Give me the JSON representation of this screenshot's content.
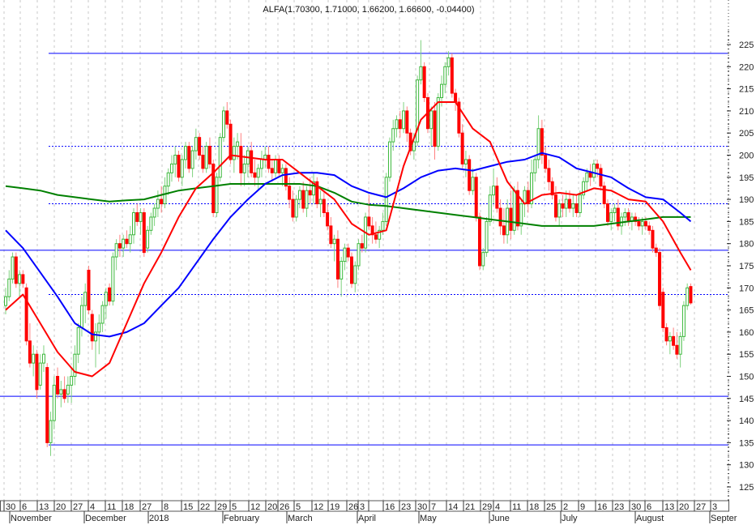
{
  "chart_data": {
    "type": "candlestick",
    "title": "ALFA(1.70300, 1.71000, 1.66200, 1.66600, -0.04400)",
    "ylim": [
      1.22,
      2.28
    ],
    "y_ticks": [
      "125",
      "130",
      "135",
      "140",
      "145",
      "150",
      "155",
      "160",
      "165",
      "170",
      "175",
      "180",
      "185",
      "190",
      "195",
      "200",
      "205",
      "210",
      "215",
      "220",
      "225"
    ],
    "y_tick_values": [
      1.25,
      1.3,
      1.35,
      1.4,
      1.45,
      1.5,
      1.55,
      1.6,
      1.65,
      1.7,
      1.75,
      1.8,
      1.85,
      1.9,
      1.95,
      2.0,
      2.05,
      2.1,
      2.15,
      2.2,
      2.25
    ],
    "x_day_ticks": [
      "30",
      "6",
      "13",
      "20",
      "27",
      "4",
      "11",
      "18",
      "27",
      "8",
      "15",
      "22",
      "29",
      "5",
      "12",
      "20",
      "26",
      "5",
      "12",
      "19",
      "26",
      "3",
      "",
      "16",
      "23",
      "30",
      "7",
      "14",
      "21",
      "29",
      "4",
      "11",
      "18",
      "25",
      "2",
      "9",
      "16",
      "23",
      "30",
      "6",
      "13",
      "20",
      "27",
      "3"
    ],
    "x_month_labels": [
      "November",
      "December",
      "2018",
      "February",
      "March",
      "April",
      "May",
      "June",
      "July",
      "August",
      "Septer"
    ],
    "grid": "vertical dotted",
    "colors": {
      "up": "#3cb83c",
      "down": "#ff0000",
      "ma_short": "#ff0000",
      "ma_mid": "#0000ff",
      "ma_long": "#008000",
      "levels": "#0000ff"
    },
    "horizontal_levels": {
      "solid": [
        2.23,
        1.785,
        1.455,
        1.345
      ],
      "dotted": [
        2.02,
        1.89,
        1.685
      ]
    },
    "candles_ohlc": [
      [
        1.66,
        1.7,
        1.64,
        1.68
      ],
      [
        1.68,
        1.74,
        1.67,
        1.72
      ],
      [
        1.72,
        1.78,
        1.71,
        1.77
      ],
      [
        1.77,
        1.78,
        1.7,
        1.71
      ],
      [
        1.71,
        1.74,
        1.68,
        1.73
      ],
      [
        1.73,
        1.74,
        1.7,
        1.71
      ],
      [
        1.7,
        1.71,
        1.57,
        1.58
      ],
      [
        1.58,
        1.62,
        1.52,
        1.53
      ],
      [
        1.53,
        1.57,
        1.5,
        1.55
      ],
      [
        1.55,
        1.56,
        1.45,
        1.47
      ],
      [
        1.48,
        1.55,
        1.47,
        1.53
      ],
      [
        1.53,
        1.57,
        1.51,
        1.55
      ],
      [
        1.52,
        1.53,
        1.34,
        1.35
      ],
      [
        1.35,
        1.42,
        1.32,
        1.4
      ],
      [
        1.4,
        1.5,
        1.38,
        1.48
      ],
      [
        1.5,
        1.52,
        1.45,
        1.46
      ],
      [
        1.46,
        1.49,
        1.43,
        1.47
      ],
      [
        1.47,
        1.5,
        1.44,
        1.45
      ],
      [
        1.46,
        1.5,
        1.44,
        1.48
      ],
      [
        1.48,
        1.52,
        1.44,
        1.5
      ],
      [
        1.5,
        1.57,
        1.48,
        1.55
      ],
      [
        1.55,
        1.62,
        1.53,
        1.61
      ],
      [
        1.61,
        1.68,
        1.59,
        1.66
      ],
      [
        1.66,
        1.71,
        1.62,
        1.69
      ],
      [
        1.74,
        1.75,
        1.64,
        1.65
      ],
      [
        1.64,
        1.65,
        1.56,
        1.58
      ],
      [
        1.58,
        1.62,
        1.52,
        1.6
      ],
      [
        1.6,
        1.64,
        1.55,
        1.62
      ],
      [
        1.62,
        1.67,
        1.6,
        1.66
      ],
      [
        1.66,
        1.7,
        1.63,
        1.69
      ],
      [
        1.7,
        1.71,
        1.66,
        1.67
      ],
      [
        1.67,
        1.78,
        1.66,
        1.77
      ],
      [
        1.77,
        1.81,
        1.74,
        1.8
      ],
      [
        1.8,
        1.82,
        1.77,
        1.79
      ],
      [
        1.79,
        1.82,
        1.77,
        1.81
      ],
      [
        1.81,
        1.83,
        1.79,
        1.8
      ],
      [
        1.8,
        1.84,
        1.78,
        1.82
      ],
      [
        1.82,
        1.88,
        1.8,
        1.87
      ],
      [
        1.87,
        1.89,
        1.84,
        1.85
      ],
      [
        1.85,
        1.88,
        1.82,
        1.87
      ],
      [
        1.87,
        1.88,
        1.77,
        1.78
      ],
      [
        1.79,
        1.84,
        1.78,
        1.83
      ],
      [
        1.83,
        1.87,
        1.82,
        1.86
      ],
      [
        1.86,
        1.89,
        1.84,
        1.88
      ],
      [
        1.88,
        1.92,
        1.86,
        1.9
      ],
      [
        1.9,
        1.93,
        1.87,
        1.89
      ],
      [
        1.89,
        1.95,
        1.88,
        1.93
      ],
      [
        1.93,
        1.97,
        1.91,
        1.96
      ],
      [
        1.96,
        2.0,
        1.94,
        1.98
      ],
      [
        1.98,
        2.02,
        1.95,
        2.0
      ],
      [
        2.0,
        2.01,
        1.94,
        1.95
      ],
      [
        1.95,
        2.0,
        1.93,
        1.99
      ],
      [
        1.99,
        2.03,
        1.97,
        2.02
      ],
      [
        2.02,
        2.03,
        1.96,
        1.97
      ],
      [
        1.97,
        2.02,
        1.95,
        2.01
      ],
      [
        2.01,
        2.06,
        1.99,
        2.04
      ],
      [
        2.04,
        2.05,
        1.99,
        2.0
      ],
      [
        2.0,
        2.02,
        1.96,
        1.97
      ],
      [
        1.97,
        2.03,
        1.96,
        2.02
      ],
      [
        2.02,
        2.04,
        1.97,
        1.98
      ],
      [
        1.98,
        1.99,
        1.86,
        1.87
      ],
      [
        1.87,
        1.96,
        1.86,
        1.95
      ],
      [
        1.95,
        2.05,
        1.94,
        2.04
      ],
      [
        2.04,
        2.11,
        2.03,
        2.1
      ],
      [
        2.1,
        2.12,
        2.06,
        2.07
      ],
      [
        2.07,
        2.08,
        1.98,
        1.99
      ],
      [
        1.99,
        2.04,
        1.96,
        2.02
      ],
      [
        2.02,
        2.05,
        1.99,
        2.03
      ],
      [
        2.02,
        2.05,
        1.93,
        1.96
      ],
      [
        1.96,
        2.0,
        1.93,
        1.98
      ],
      [
        1.98,
        2.02,
        1.95,
        2.01
      ],
      [
        2.01,
        2.03,
        1.95,
        1.96
      ],
      [
        1.96,
        1.99,
        1.93,
        1.95
      ],
      [
        1.95,
        1.98,
        1.92,
        1.97
      ],
      [
        1.97,
        2.01,
        1.95,
        1.99
      ],
      [
        1.99,
        2.02,
        1.97,
        2.0
      ],
      [
        2.0,
        2.02,
        1.96,
        1.97
      ],
      [
        1.97,
        1.99,
        1.94,
        1.96
      ],
      [
        1.96,
        2.0,
        1.95,
        1.99
      ],
      [
        1.99,
        2.0,
        1.95,
        1.96
      ],
      [
        1.96,
        1.98,
        1.93,
        1.97
      ],
      [
        1.97,
        1.98,
        1.92,
        1.93
      ],
      [
        1.93,
        1.95,
        1.88,
        1.9
      ],
      [
        1.9,
        1.92,
        1.85,
        1.86
      ],
      [
        1.86,
        1.91,
        1.85,
        1.9
      ],
      [
        1.9,
        1.93,
        1.88,
        1.92
      ],
      [
        1.92,
        1.94,
        1.87,
        1.88
      ],
      [
        1.88,
        1.93,
        1.86,
        1.92
      ],
      [
        1.92,
        1.95,
        1.89,
        1.91
      ],
      [
        1.91,
        1.96,
        1.89,
        1.94
      ],
      [
        1.94,
        1.95,
        1.88,
        1.89
      ],
      [
        1.89,
        1.92,
        1.86,
        1.9
      ],
      [
        1.9,
        1.92,
        1.86,
        1.87
      ],
      [
        1.87,
        1.89,
        1.83,
        1.84
      ],
      [
        1.84,
        1.86,
        1.79,
        1.8
      ],
      [
        1.8,
        1.82,
        1.76,
        1.81
      ],
      [
        1.81,
        1.83,
        1.7,
        1.72
      ],
      [
        1.72,
        1.77,
        1.68,
        1.76
      ],
      [
        1.76,
        1.8,
        1.74,
        1.79
      ],
      [
        1.79,
        1.8,
        1.76,
        1.77
      ],
      [
        1.77,
        1.78,
        1.7,
        1.71
      ],
      [
        1.71,
        1.76,
        1.69,
        1.75
      ],
      [
        1.75,
        1.81,
        1.74,
        1.8
      ],
      [
        1.8,
        1.82,
        1.78,
        1.79
      ],
      [
        1.79,
        1.87,
        1.78,
        1.86
      ],
      [
        1.86,
        1.91,
        1.83,
        1.84
      ],
      [
        1.84,
        1.86,
        1.8,
        1.82
      ],
      [
        1.82,
        1.85,
        1.8,
        1.81
      ],
      [
        1.81,
        1.84,
        1.79,
        1.83
      ],
      [
        1.83,
        1.87,
        1.82,
        1.85
      ],
      [
        1.85,
        1.96,
        1.84,
        1.95
      ],
      [
        1.95,
        2.04,
        1.94,
        2.03
      ],
      [
        2.03,
        2.08,
        2.01,
        2.06
      ],
      [
        2.06,
        2.09,
        2.04,
        2.08
      ],
      [
        2.08,
        2.1,
        2.04,
        2.06
      ],
      [
        2.06,
        2.12,
        2.05,
        2.1
      ],
      [
        2.1,
        2.11,
        2.03,
        2.05
      ],
      [
        2.05,
        2.06,
        2.0,
        2.01
      ],
      [
        2.01,
        2.05,
        1.99,
        2.03
      ],
      [
        2.03,
        2.18,
        2.02,
        2.17
      ],
      [
        2.17,
        2.26,
        2.16,
        2.2
      ],
      [
        2.2,
        2.21,
        2.12,
        2.13
      ],
      [
        2.13,
        2.14,
        2.05,
        2.06
      ],
      [
        2.06,
        2.11,
        2.02,
        2.1
      ],
      [
        2.1,
        2.12,
        1.99,
        2.02
      ],
      [
        2.02,
        2.14,
        2.01,
        2.13
      ],
      [
        2.13,
        2.18,
        2.11,
        2.16
      ],
      [
        2.16,
        2.21,
        2.14,
        2.2
      ],
      [
        2.2,
        2.235,
        2.18,
        2.22
      ],
      [
        2.22,
        2.23,
        2.13,
        2.14
      ],
      [
        2.14,
        2.15,
        2.1,
        2.12
      ],
      [
        2.12,
        2.13,
        2.04,
        2.05
      ],
      [
        2.05,
        2.07,
        1.97,
        1.98
      ],
      [
        1.98,
        2.01,
        1.95,
        1.99
      ],
      [
        1.99,
        2.0,
        1.91,
        1.92
      ],
      [
        1.92,
        1.97,
        1.91,
        1.95
      ],
      [
        1.95,
        1.96,
        1.85,
        1.86
      ],
      [
        1.86,
        1.87,
        1.74,
        1.75
      ],
      [
        1.75,
        1.79,
        1.74,
        1.78
      ],
      [
        1.78,
        1.86,
        1.77,
        1.85
      ],
      [
        1.85,
        1.93,
        1.84,
        1.91
      ],
      [
        1.91,
        1.97,
        1.89,
        1.93
      ],
      [
        1.93,
        1.95,
        1.87,
        1.88
      ],
      [
        1.88,
        1.9,
        1.82,
        1.84
      ],
      [
        1.84,
        1.88,
        1.8,
        1.82
      ],
      [
        1.82,
        1.9,
        1.8,
        1.88
      ],
      [
        1.88,
        1.92,
        1.81,
        1.83
      ],
      [
        1.83,
        1.93,
        1.82,
        1.92
      ],
      [
        1.92,
        1.94,
        1.83,
        1.84
      ],
      [
        1.84,
        1.9,
        1.82,
        1.89
      ],
      [
        1.89,
        1.93,
        1.86,
        1.92
      ],
      [
        1.92,
        1.94,
        1.87,
        1.89
      ],
      [
        1.89,
        1.99,
        1.88,
        1.96
      ],
      [
        1.96,
        2.0,
        1.94,
        1.99
      ],
      [
        1.99,
        2.09,
        1.97,
        2.06
      ],
      [
        2.06,
        2.08,
        1.98,
        2.0
      ],
      [
        2.0,
        2.02,
        1.96,
        1.97
      ],
      [
        1.97,
        1.99,
        1.92,
        1.94
      ],
      [
        1.94,
        1.95,
        1.9,
        1.91
      ],
      [
        1.91,
        1.93,
        1.85,
        1.86
      ],
      [
        1.86,
        1.9,
        1.84,
        1.89
      ],
      [
        1.89,
        1.91,
        1.86,
        1.88
      ],
      [
        1.88,
        1.92,
        1.86,
        1.9
      ],
      [
        1.9,
        1.92,
        1.87,
        1.88
      ],
      [
        1.88,
        1.91,
        1.86,
        1.89
      ],
      [
        1.89,
        1.91,
        1.86,
        1.87
      ],
      [
        1.87,
        1.92,
        1.86,
        1.91
      ],
      [
        1.91,
        1.95,
        1.9,
        1.94
      ],
      [
        1.94,
        1.97,
        1.92,
        1.96
      ],
      [
        1.96,
        1.98,
        1.93,
        1.95
      ],
      [
        1.95,
        1.99,
        1.94,
        1.98
      ],
      [
        1.98,
        1.99,
        1.95,
        1.97
      ],
      [
        1.97,
        1.98,
        1.92,
        1.93
      ],
      [
        1.93,
        1.94,
        1.88,
        1.89
      ],
      [
        1.89,
        1.9,
        1.84,
        1.85
      ],
      [
        1.85,
        1.88,
        1.83,
        1.87
      ],
      [
        1.87,
        1.89,
        1.85,
        1.88
      ],
      [
        1.88,
        1.9,
        1.83,
        1.84
      ],
      [
        1.84,
        1.87,
        1.82,
        1.86
      ],
      [
        1.86,
        1.88,
        1.84,
        1.87
      ],
      [
        1.87,
        1.88,
        1.84,
        1.85
      ],
      [
        1.85,
        1.87,
        1.83,
        1.86
      ],
      [
        1.86,
        1.87,
        1.84,
        1.85
      ],
      [
        1.85,
        1.86,
        1.83,
        1.84
      ],
      [
        1.84,
        1.86,
        1.82,
        1.85
      ],
      [
        1.85,
        1.86,
        1.83,
        1.84
      ],
      [
        1.84,
        1.85,
        1.82,
        1.83
      ],
      [
        1.83,
        1.84,
        1.78,
        1.79
      ],
      [
        1.79,
        1.8,
        1.77,
        1.78
      ],
      [
        1.78,
        1.79,
        1.65,
        1.66
      ],
      [
        1.69,
        1.7,
        1.6,
        1.61
      ],
      [
        1.61,
        1.62,
        1.57,
        1.58
      ],
      [
        1.58,
        1.6,
        1.55,
        1.59
      ],
      [
        1.59,
        1.61,
        1.56,
        1.57
      ],
      [
        1.57,
        1.6,
        1.54,
        1.55
      ],
      [
        1.55,
        1.6,
        1.52,
        1.59
      ],
      [
        1.59,
        1.67,
        1.58,
        1.66
      ],
      [
        1.66,
        1.71,
        1.65,
        1.7
      ],
      [
        1.703,
        1.71,
        1.662,
        1.666
      ]
    ],
    "moving_averages_weekly_samples": {
      "red": [
        1.65,
        1.685,
        1.62,
        1.555,
        1.51,
        1.5,
        1.53,
        1.62,
        1.71,
        1.78,
        1.86,
        1.925,
        1.96,
        2.0,
        1.995,
        1.99,
        1.99,
        1.96,
        1.93,
        1.9,
        1.845,
        1.82,
        1.83,
        1.975,
        2.08,
        2.12,
        2.12,
        2.06,
        2.03,
        1.94,
        1.89,
        1.91,
        1.915,
        1.91,
        1.925,
        1.92,
        1.9,
        1.895,
        1.85,
        1.78,
        1.74
      ],
      "blue": [
        1.83,
        1.79,
        1.735,
        1.68,
        1.62,
        1.595,
        1.59,
        1.6,
        1.62,
        1.66,
        1.7,
        1.755,
        1.81,
        1.86,
        1.9,
        1.935,
        1.955,
        1.96,
        1.96,
        1.955,
        1.93,
        1.915,
        1.905,
        1.925,
        1.95,
        1.965,
        1.97,
        1.965,
        1.975,
        1.985,
        1.99,
        2.005,
        1.995,
        1.97,
        1.96,
        1.95,
        1.925,
        1.905,
        1.9,
        1.87,
        1.85
      ],
      "green": [
        1.93,
        1.925,
        1.92,
        1.91,
        1.905,
        1.9,
        1.895,
        1.898,
        1.9,
        1.91,
        1.92,
        1.925,
        1.93,
        1.935,
        1.935,
        1.935,
        1.935,
        1.935,
        1.93,
        1.915,
        1.895,
        1.888,
        1.885,
        1.88,
        1.875,
        1.87,
        1.865,
        1.86,
        1.855,
        1.85,
        1.845,
        1.84,
        1.84,
        1.84,
        1.84,
        1.845,
        1.85,
        1.855,
        1.86,
        1.86,
        1.86
      ]
    }
  }
}
